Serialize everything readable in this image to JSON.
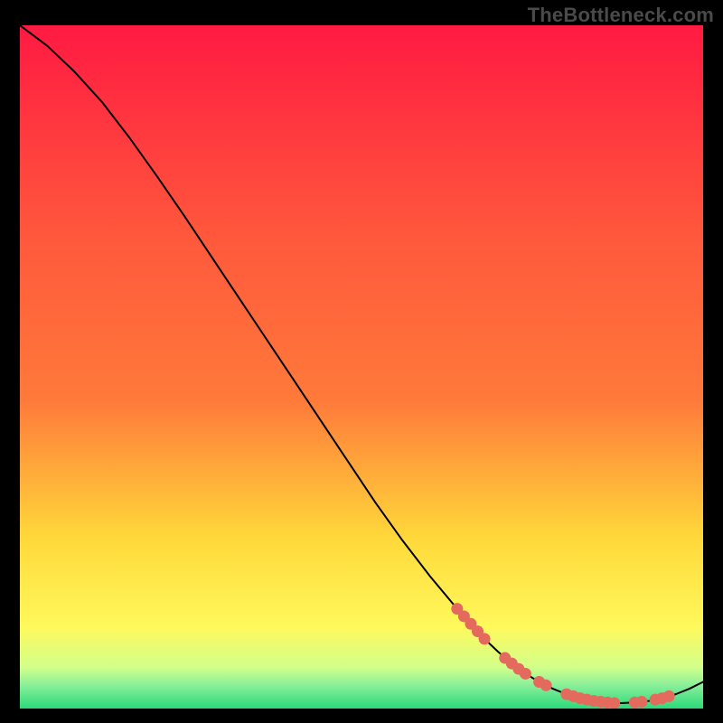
{
  "watermark": "TheBottleneck.com",
  "colors": {
    "gradient_top": "#ff1a42",
    "gradient_mid1": "#ff7a3a",
    "gradient_mid2": "#ffd83a",
    "gradient_mid3": "#fff95c",
    "gradient_mid4": "#d2ff8a",
    "gradient_bottom": "#2bd97b",
    "curve": "#000000",
    "dot_fill": "#e46a5e",
    "dot_stroke": "#c94f44"
  },
  "chart_data": {
    "type": "line",
    "title": "",
    "xlabel": "",
    "ylabel": "",
    "xlim": [
      0,
      100
    ],
    "ylim": [
      0,
      100
    ],
    "grid": false,
    "series": [
      {
        "name": "bottleneck-curve",
        "x": [
          0,
          4,
          8,
          12,
          16,
          20,
          24,
          28,
          32,
          36,
          40,
          44,
          48,
          52,
          56,
          60,
          64,
          68,
          70,
          72,
          74,
          76,
          78,
          80,
          82,
          84,
          86,
          88,
          90,
          92,
          94,
          96,
          98,
          100
        ],
        "y": [
          100,
          97,
          93.2,
          88.8,
          83.6,
          78,
          72.2,
          66.2,
          60.2,
          54.2,
          48.2,
          42.2,
          36.2,
          30.2,
          24.6,
          19.4,
          14.6,
          10.2,
          8.3,
          6.6,
          5.1,
          3.9,
          2.9,
          2.1,
          1.5,
          1.1,
          0.9,
          0.8,
          0.9,
          1.1,
          1.5,
          2.1,
          2.9,
          3.9
        ]
      }
    ],
    "dots_x": [
      64,
      65,
      66,
      67,
      68,
      71,
      72,
      73,
      74,
      76,
      77,
      80,
      81,
      82,
      83,
      84,
      85,
      86,
      87,
      90,
      91,
      93,
      94,
      95
    ],
    "dots_y": [
      14.6,
      13.5,
      12.4,
      11.3,
      10.2,
      7.4,
      6.6,
      5.8,
      5.1,
      3.9,
      3.4,
      2.1,
      1.8,
      1.5,
      1.3,
      1.1,
      1.0,
      0.9,
      0.8,
      0.9,
      1.0,
      1.3,
      1.5,
      1.8
    ]
  }
}
